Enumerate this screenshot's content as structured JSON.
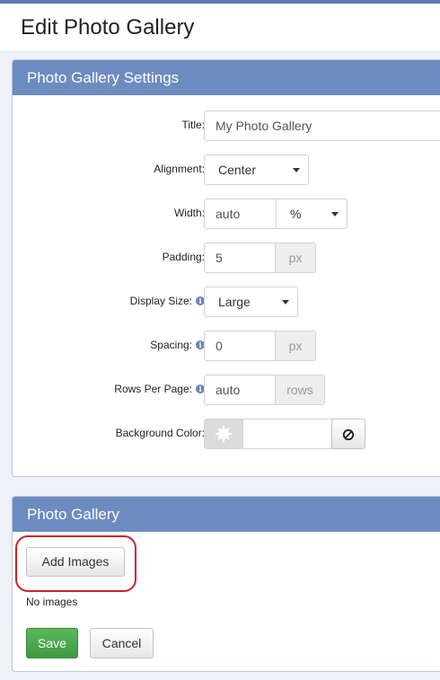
{
  "page": {
    "title": "Edit Photo Gallery"
  },
  "settings_panel": {
    "heading": "Photo Gallery Settings",
    "title_field": {
      "label": "Title:",
      "value": "My Photo Gallery"
    },
    "alignment": {
      "label": "Alignment:",
      "selected": "Center"
    },
    "width": {
      "label": "Width:",
      "value": "auto",
      "unit_selected": "%"
    },
    "padding": {
      "label": "Padding:",
      "value": "5",
      "unit": "px"
    },
    "display_size": {
      "label": "Display Size:",
      "selected": "Large"
    },
    "spacing": {
      "label": "Spacing:",
      "value": "0",
      "unit": "px"
    },
    "rows_per_page": {
      "label": "Rows Per Page:",
      "value": "auto",
      "unit": "rows"
    },
    "background_color": {
      "label": "Background Color:",
      "value": ""
    }
  },
  "gallery_panel": {
    "heading": "Photo Gallery",
    "add_images_label": "Add Images",
    "empty_text": "No images"
  },
  "actions": {
    "save_label": "Save",
    "cancel_label": "Cancel"
  },
  "colors": {
    "panel_heading": "#6c8cc0",
    "success": "#5cb85c",
    "highlight": "#d0202a"
  }
}
